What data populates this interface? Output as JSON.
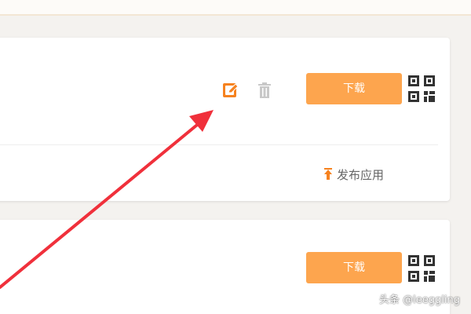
{
  "apps": [
    {
      "download_label": "下载",
      "has_edit": true,
      "has_delete": true,
      "publish_label": "发布应用"
    },
    {
      "download_label": "下载"
    }
  ],
  "icons": {
    "edit": "edit-icon",
    "delete": "trash-icon",
    "qr": "qr-code-icon",
    "publish": "pin-icon"
  },
  "annotation": {
    "arrow_color": "#f0303b"
  },
  "colors": {
    "accent": "#fda54e",
    "edit_icon": "#f6821f",
    "delete_icon": "#c8c8c8",
    "publish_icon": "#f6821f"
  },
  "watermark": "头条 @leeggling"
}
